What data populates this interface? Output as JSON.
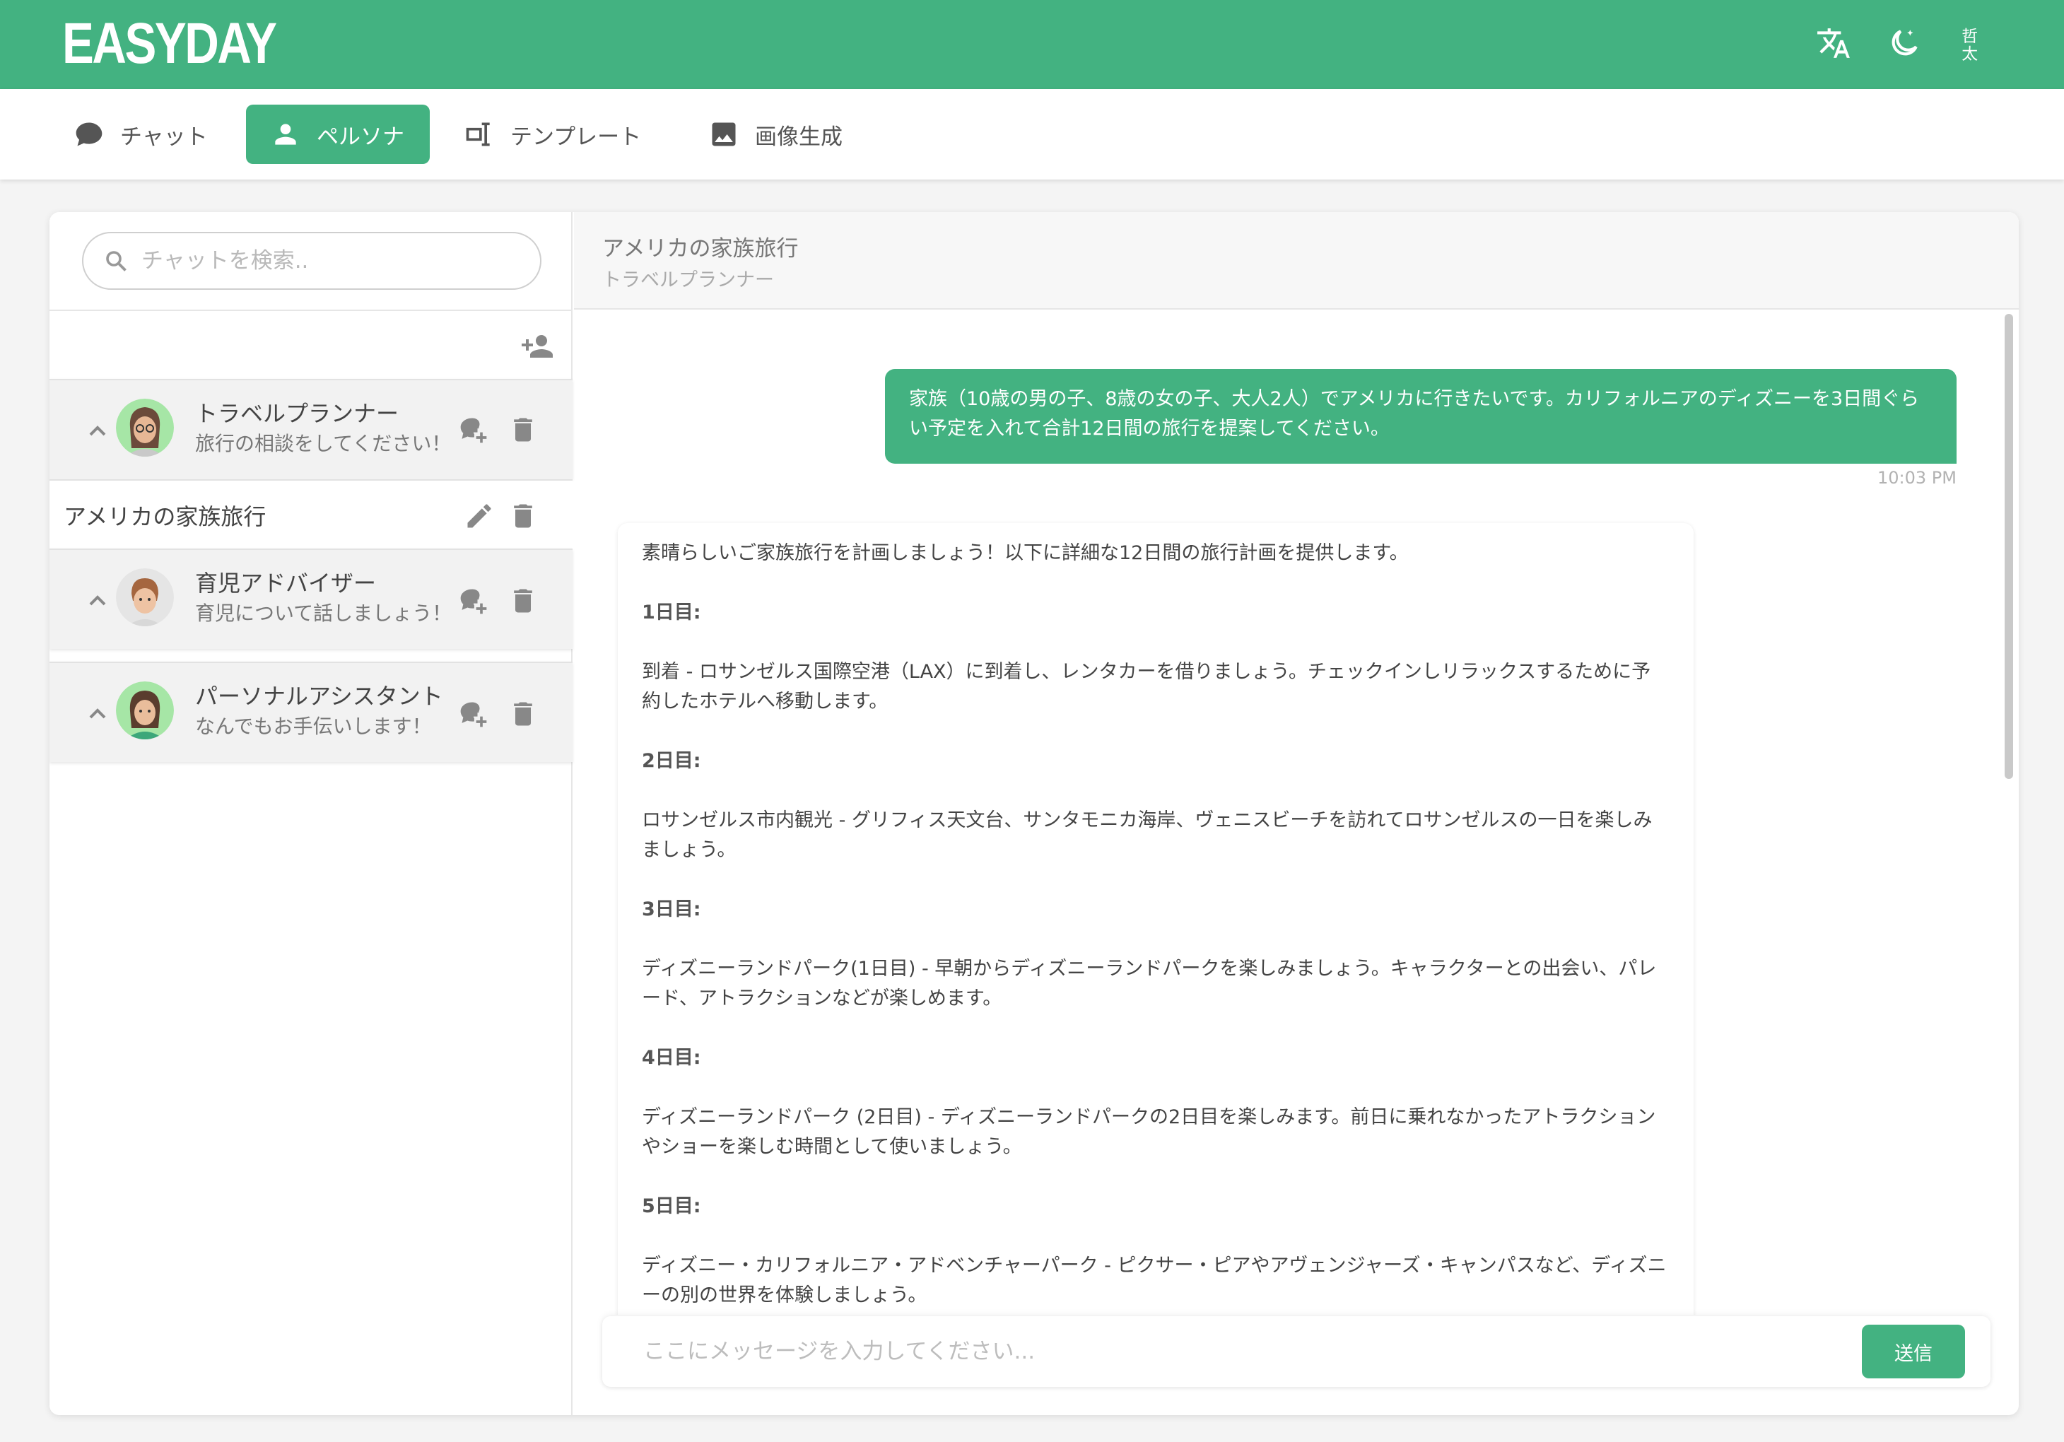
{
  "app": {
    "logo": "EASYDAY"
  },
  "header_icons": [
    "translate-icon",
    "dark-mode-icon",
    "font-icon"
  ],
  "colors": {
    "accent": "#43b281",
    "background": "#f4f4f4"
  },
  "tabs": [
    {
      "label": "チャット",
      "icon": "chat-bubble-icon",
      "active": false
    },
    {
      "label": "ペルソナ",
      "icon": "person-icon",
      "active": true
    },
    {
      "label": "テンプレート",
      "icon": "template-icon",
      "active": false
    },
    {
      "label": "画像生成",
      "icon": "image-icon",
      "active": false
    }
  ],
  "sidebar": {
    "search_placeholder": "チャットを検索..",
    "personas": [
      {
        "name": "トラベルプランナー",
        "desc": "旅行の相談をしてください！",
        "avatar": "male-glasses-avatar"
      },
      {
        "name": "育児アドバイザー",
        "desc": "育児について話しましょう！",
        "avatar": "child-avatar"
      },
      {
        "name": "パーソナルアシスタント",
        "desc": "なんでもお手伝いします！",
        "avatar": "female-avatar"
      }
    ],
    "chat_item": {
      "title": "アメリカの家族旅行"
    }
  },
  "chat": {
    "title": "アメリカの家族旅行",
    "persona": "トラベルプランナー",
    "user_message": "家族（10歳の男の子、8歳の女の子、大人2人）でアメリカに行きたいです。カリフォルニアのディズニーを3日間ぐらい予定を入れて合計12日間の旅行を提案してください。",
    "timestamp": "10:03 PM",
    "assistant": {
      "intro": "素晴らしいご家族旅行を計画しましょう！以下に詳細な12日間の旅行計画を提供します。",
      "days": [
        {
          "label": "1日目:",
          "text": "到着 - ロサンゼルス国際空港（LAX）に到着し、レンタカーを借りましょう。チェックインしリラックスするために予約したホテルへ移動します。"
        },
        {
          "label": "2日目:",
          "text": "ロサンゼルス市内観光 - グリフィス天文台、サンタモニカ海岸、ヴェニスビーチを訪れてロサンゼルスの一日を楽しみましょう。"
        },
        {
          "label": "3日目:",
          "text": "ディズニーランドパーク(1日目) - 早朝からディズニーランドパークを楽しみましょう。キャラクターとの出会い、パレード、アトラクションなどが楽しめます。"
        },
        {
          "label": "4日目:",
          "text": "ディズニーランドパーク (2日目) - ディズニーランドパークの2日目を楽しみます。前日に乗れなかったアトラクションやショーを楽しむ時間として使いましょう。"
        },
        {
          "label": "5日目:",
          "text": "ディズニー・カリフォルニア・アドベンチャーパーク - ピクサー・ピアやアヴェンジャーズ・キャンパスなど、ディズニーの別の世界を体験しましょう。"
        }
      ]
    },
    "input_placeholder": "ここにメッセージを入力してください...",
    "send_label": "送信"
  }
}
